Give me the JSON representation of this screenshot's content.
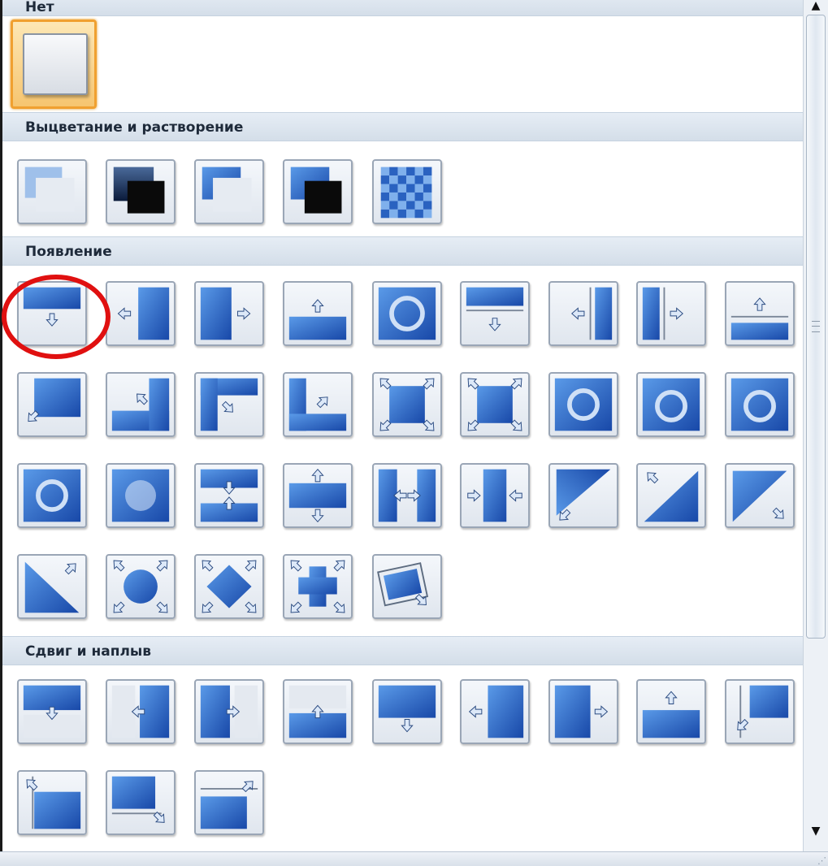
{
  "sections": [
    {
      "label": "Нет"
    },
    {
      "label": "Выцветание и растворение"
    },
    {
      "label": "Появление"
    },
    {
      "label": "Сдвиг и наплыв"
    }
  ],
  "selected_item": "none",
  "highlighted_item": "appear-down",
  "colors": {
    "accent_blue": "#1f5fbf",
    "selection_orange": "#f0a030",
    "highlight_red": "#e01010"
  },
  "icons": {
    "scroll_up": "▲",
    "scroll_down": "▼",
    "resize_grip": "⋰"
  }
}
